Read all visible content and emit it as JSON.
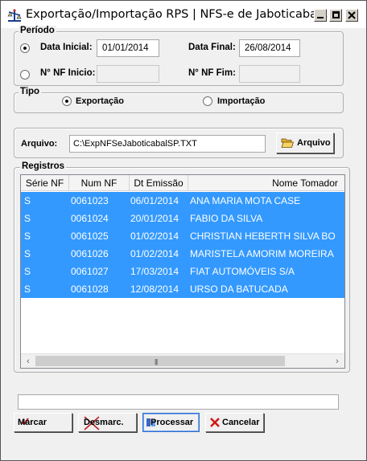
{
  "window": {
    "title": "Exportação/Importação RPS  |  NFS-e de Jaboticaba...",
    "app_icon": "scales-icon",
    "controls": [
      "minimize-icon",
      "maximize-icon",
      "close-icon"
    ]
  },
  "periodo": {
    "group_label": "Período",
    "data_inicial_label": "Data Inicial:",
    "data_inicial_value": "01/01/2014",
    "data_final_label": "Data Final:",
    "data_final_value": "26/08/2014",
    "nf_inicio_label": "N° NF Inicio:",
    "nf_inicio_value": "",
    "nf_fim_label": "N° NF Fim:",
    "nf_fim_value": "",
    "selected": "data"
  },
  "tipo": {
    "group_label": "Tipo",
    "exportacao_label": "Exportação",
    "importacao_label": "Importação",
    "selected": "exportacao"
  },
  "arquivo": {
    "label": "Arquivo:",
    "value": "C:\\ExpNFSeJaboticabalSP.TXT",
    "button_label": "Arquivo",
    "button_icon": "folder-open-icon"
  },
  "registros": {
    "group_label": "Registros",
    "columns": [
      "Série NF",
      "Num NF",
      "Dt Emissão",
      "Nome Tomador"
    ],
    "rows": [
      {
        "serie": "S",
        "num": "0061023",
        "data": "06/01/2014",
        "nome": "ANA MARIA MOTA CASE"
      },
      {
        "serie": "S",
        "num": "0061024",
        "data": "20/01/2014",
        "nome": "FABIO DA SILVA"
      },
      {
        "serie": "S",
        "num": "0061025",
        "data": "01/02/2014",
        "nome": "CHRISTIAN HEBERTH SILVA  BO"
      },
      {
        "serie": "S",
        "num": "0061026",
        "data": "01/02/2014",
        "nome": "MARISTELA AMORIM MOREIRA"
      },
      {
        "serie": "S",
        "num": "0061027",
        "data": "17/03/2014",
        "nome": "FIAT AUTOMÓVEIS S/A"
      },
      {
        "serie": "S",
        "num": "0061028",
        "data": "12/08/2014",
        "nome": "URSO DA BATUCADA"
      }
    ],
    "selection_color": "#3399ff"
  },
  "progress": {
    "value": 0
  },
  "buttons": {
    "marcar": "Marcar",
    "desmarcar": "Desmarc.",
    "processar": "Processar",
    "cancelar": "Cancelar"
  }
}
